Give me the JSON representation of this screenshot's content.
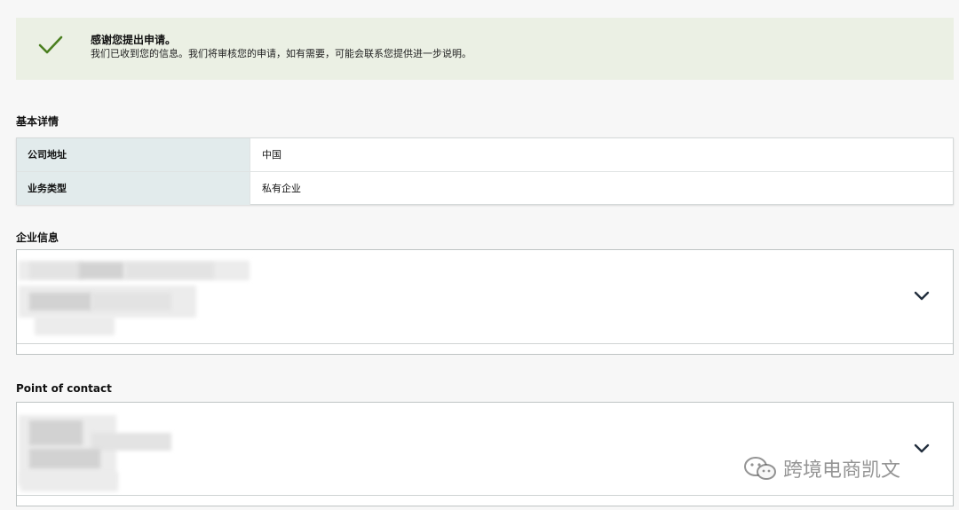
{
  "alert": {
    "title": "感谢您提出申请。",
    "message": "我们已收到您的信息。我们将审核您的申请，如有需要，可能会联系您提供进一步说明。",
    "color": "#ebf0e4",
    "icon": "check-icon"
  },
  "basic_details": {
    "heading": "基本详情",
    "rows": [
      {
        "label": "公司地址",
        "value": "中国"
      },
      {
        "label": "业务类型",
        "value": "私有企业"
      }
    ]
  },
  "business_info": {
    "heading": "企业信息",
    "icon": "chevron-down-icon"
  },
  "point_of_contact": {
    "heading": "Point of contact",
    "icon": "chevron-down-icon"
  },
  "watermark": {
    "text": "跨境电商凯文",
    "icon": "wechat-icon"
  }
}
